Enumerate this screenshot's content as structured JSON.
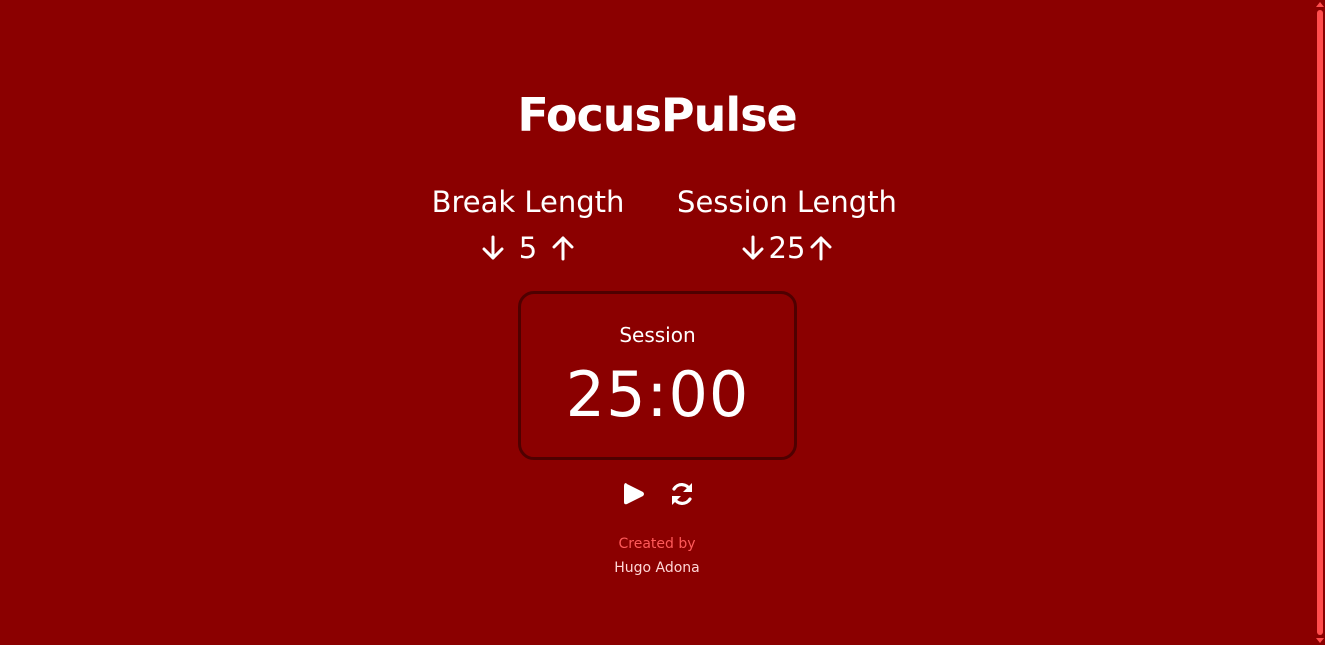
{
  "app": {
    "title": "FocusPulse"
  },
  "break": {
    "label": "Break Length",
    "value": "5"
  },
  "session": {
    "label": "Session Length",
    "value": "25"
  },
  "timer": {
    "label": "Session",
    "time": "25:00"
  },
  "icons": {
    "decrement": "arrow-down-icon",
    "increment": "arrow-up-icon",
    "play": "play-icon",
    "reset": "refresh-icon"
  },
  "footer": {
    "created_by": "Created by",
    "author": "Hugo Adona"
  },
  "colors": {
    "background": "#8b0000",
    "timer_border": "#4f0000",
    "footer_accent": "#ff5a5a",
    "scrollbar": "#ff4d4d"
  }
}
